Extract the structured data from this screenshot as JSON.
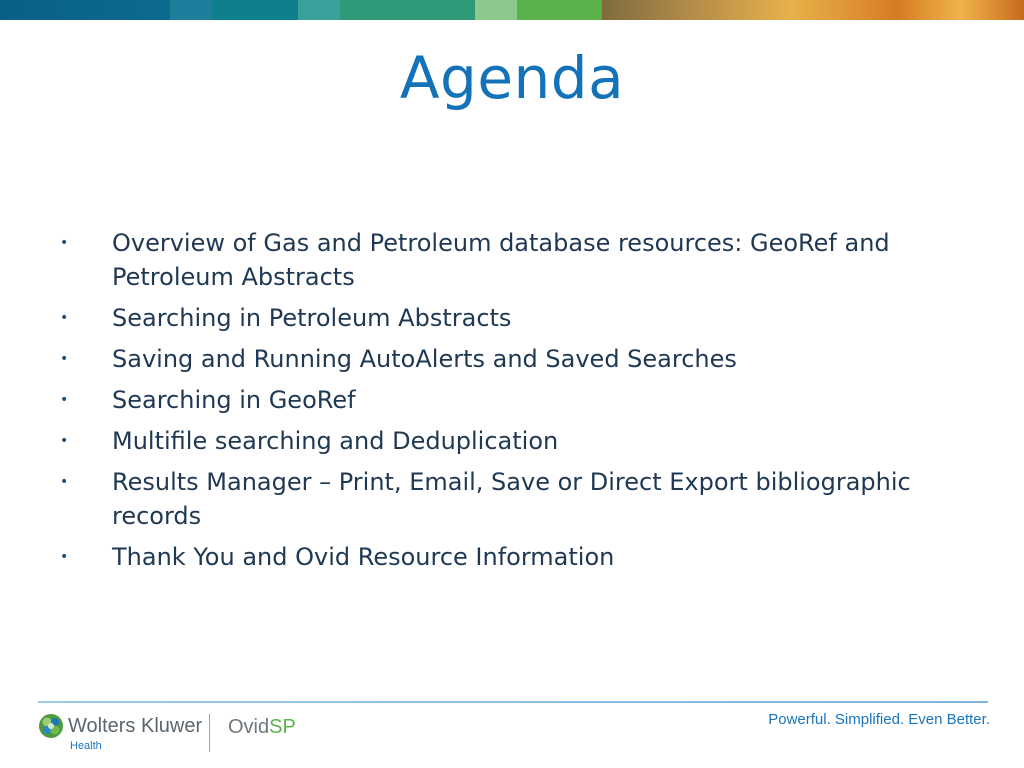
{
  "slide": {
    "title": "Agenda",
    "items": [
      "Overview of Gas and Petroleum database resources:  GeoRef and Petroleum Abstracts",
      "Searching in Petroleum Abstracts",
      "Saving and Running AutoAlerts and Saved Searches",
      "Searching in GeoRef",
      "Multifile searching and Deduplication",
      "Results Manager – Print, Email, Save or Direct Export bibliographic records",
      "Thank You and Ovid Resource Information"
    ]
  },
  "footer": {
    "brand": "Wolters Kluwer",
    "brand_sub": "Health",
    "product_prefix": "Ovid",
    "product_suffix": "SP",
    "tagline": "Powerful. Simplified. Even Better."
  },
  "colors": {
    "title": "#1473b8",
    "text": "#1f3853",
    "brand_blue": "#1b75bb",
    "brand_green": "#5ab34a"
  },
  "icons": {
    "bullet": "bullet-icon",
    "logo": "wolters-kluwer-globe-icon"
  }
}
